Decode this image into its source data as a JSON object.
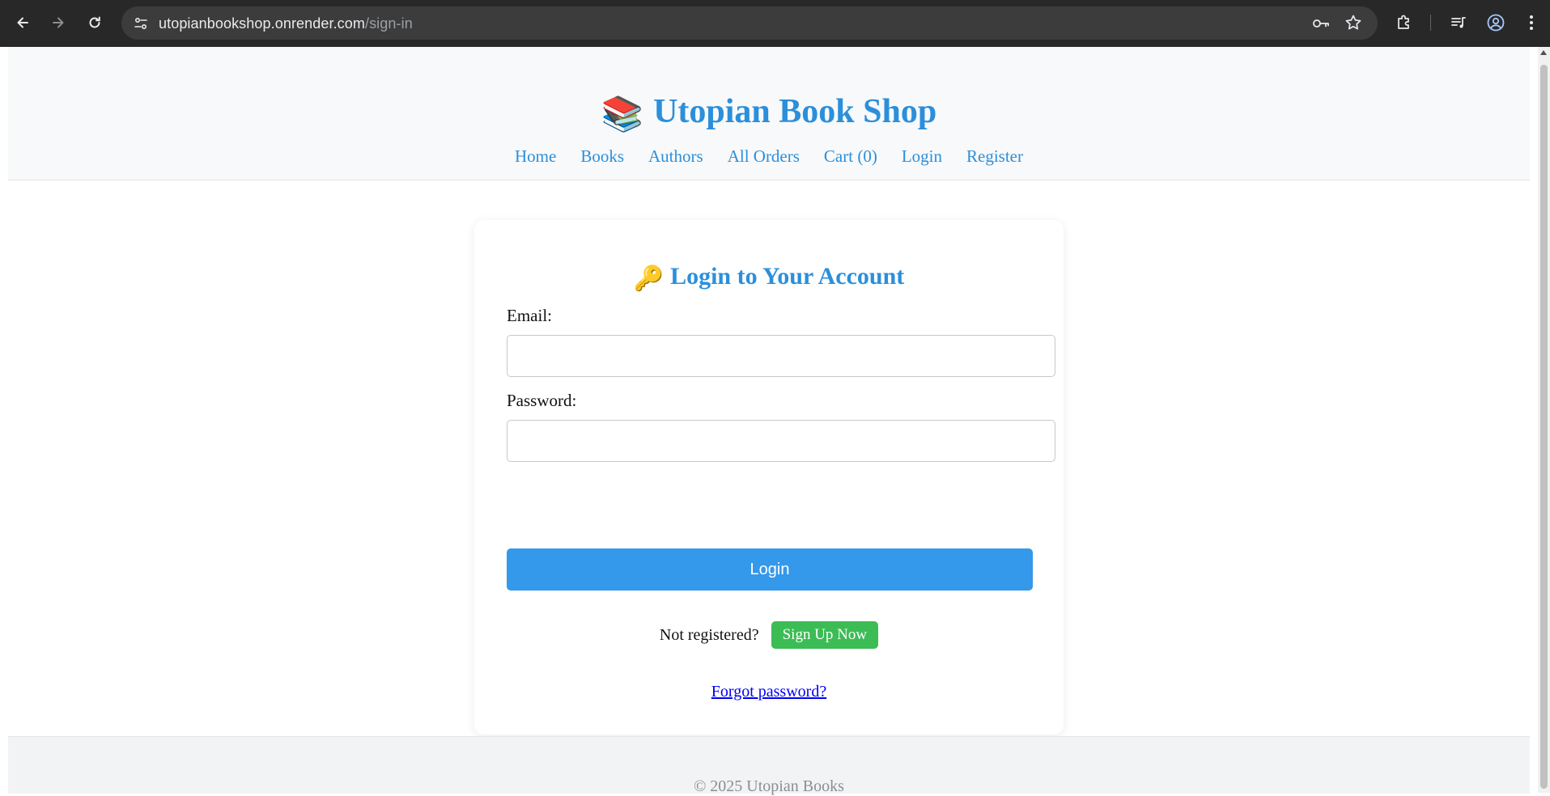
{
  "browser": {
    "url_host": "utopianbookshop.onrender.com",
    "url_path": "/sign-in"
  },
  "header": {
    "logo_emoji": "📚",
    "title": "Utopian Book Shop",
    "nav": [
      {
        "label": "Home"
      },
      {
        "label": "Books"
      },
      {
        "label": "Authors"
      },
      {
        "label": "All Orders"
      },
      {
        "label": "Cart (0)"
      },
      {
        "label": "Login"
      },
      {
        "label": "Register"
      }
    ]
  },
  "login": {
    "title_emoji": "🔑",
    "title": "Login to Your Account",
    "email_label": "Email:",
    "email_value": "",
    "password_label": "Password:",
    "password_value": "",
    "submit_label": "Login",
    "not_registered_text": "Not registered?",
    "signup_label": "Sign Up Now",
    "forgot_label": "Forgot password?"
  },
  "footer": {
    "copyright": "© 2025 Utopian Books"
  },
  "colors": {
    "accent": "#2b8fdb",
    "button_primary": "#3498eb",
    "button_success": "#3cbc55",
    "link": "#0000ee"
  }
}
